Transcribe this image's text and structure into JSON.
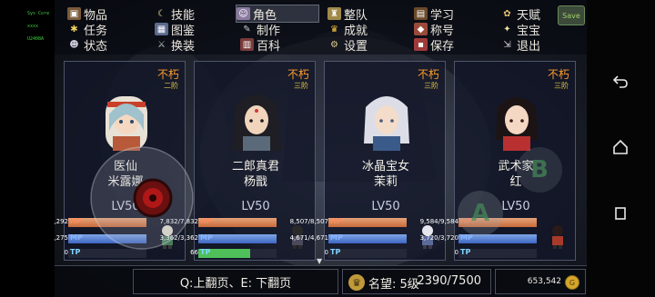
{
  "status": {
    "line1": "Sys Core",
    "line2": "xxxx",
    "line3": "U2408A"
  },
  "menu": {
    "items": [
      {
        "label": "物品",
        "icon": "bag-icon"
      },
      {
        "label": "技能",
        "icon": "skill-icon"
      },
      {
        "label": "角色",
        "icon": "character-icon",
        "active": true
      },
      {
        "label": "整队",
        "icon": "party-icon"
      },
      {
        "label": "学习",
        "icon": "book-icon"
      },
      {
        "label": "天赋",
        "icon": "talent-icon"
      },
      {
        "label": "任务",
        "icon": "quest-icon"
      },
      {
        "label": "图鉴",
        "icon": "codex-icon"
      },
      {
        "label": "制作",
        "icon": "craft-icon"
      },
      {
        "label": "成就",
        "icon": "trophy-icon"
      },
      {
        "label": "称号",
        "icon": "title-icon"
      },
      {
        "label": "宝宝",
        "icon": "pet-icon"
      },
      {
        "label": "状态",
        "icon": "status-icon"
      },
      {
        "label": "换装",
        "icon": "outfit-icon"
      },
      {
        "label": "百科",
        "icon": "encyclopedia-icon"
      },
      {
        "label": "设置",
        "icon": "settings-icon"
      },
      {
        "label": "保存",
        "icon": "save-icon"
      },
      {
        "label": "退出",
        "icon": "exit-icon"
      }
    ],
    "save_button": "Save"
  },
  "characters": [
    {
      "trait": "不朽",
      "rank": "二阶",
      "title": "医仙",
      "name": "米露娜",
      "level": "LV50",
      "hp": "8,292/8,292",
      "mp": "5,275/5,275",
      "tp": "0",
      "hp_ratio": 1,
      "mp_ratio": 1,
      "tp_ratio": 0
    },
    {
      "trait": "不朽",
      "rank": "三阶",
      "title": "二郎真君",
      "name": "杨戬",
      "level": "LV50",
      "hp": "7,832/7,832",
      "mp": "3,362/3,362",
      "tp": "66",
      "hp_ratio": 1,
      "mp_ratio": 1,
      "tp_ratio": 0.66
    },
    {
      "trait": "不朽",
      "rank": "三阶",
      "title": "冰晶宝女",
      "name": "茉莉",
      "level": "LV50",
      "hp": "8,507/8,507",
      "mp": "4,671/4,671",
      "tp": "0",
      "hp_ratio": 1,
      "mp_ratio": 1,
      "tp_ratio": 0
    },
    {
      "trait": "不朽",
      "rank": "三阶",
      "title": "武术家",
      "name": "红",
      "level": "LV50",
      "hp": "9,584/9,584",
      "mp": "3,720/3,720",
      "tp": "0",
      "hp_ratio": 1,
      "mp_ratio": 1,
      "tp_ratio": 0
    }
  ],
  "stat_labels": {
    "hp": "HP",
    "mp": "MP",
    "tp": "TP"
  },
  "footer": {
    "page_hint": "Q:上翻页、E: 下翻页",
    "fame_label": "名望: 5级",
    "fame_value": "2390/7500",
    "gold": "653,542"
  },
  "controls": {
    "a_button": "A",
    "b_button": "B"
  }
}
